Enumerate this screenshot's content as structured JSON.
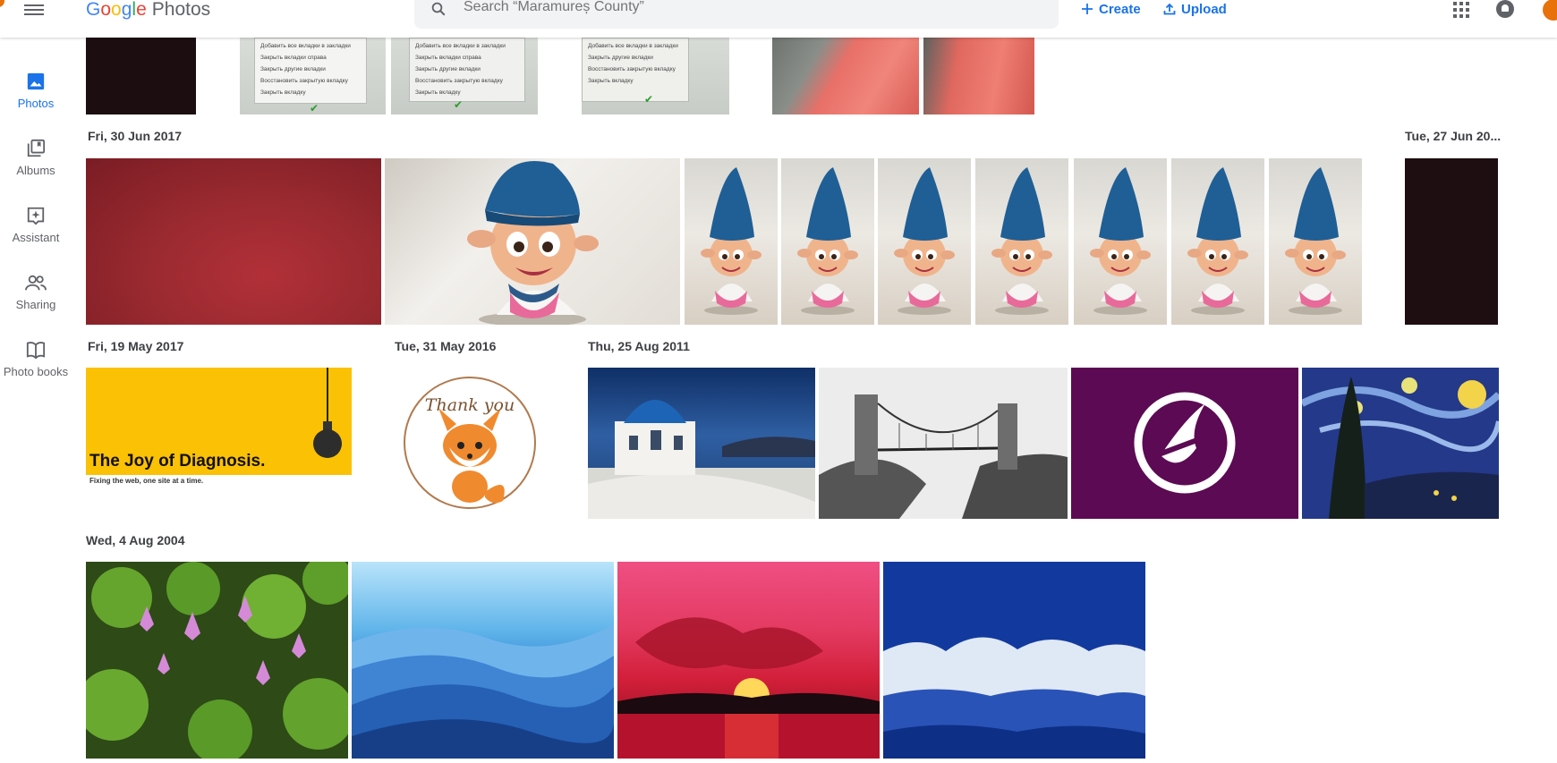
{
  "header": {
    "logo_google": "Google",
    "logo_product": "Photos",
    "search_placeholder": "Search “Maramureș County”",
    "create_label": "Create",
    "upload_label": "Upload",
    "icons": [
      "menu-icon",
      "search-icon",
      "plus-icon",
      "upload-icon",
      "apps-icon",
      "notifications-icon",
      "avatar"
    ]
  },
  "sidebar": {
    "items": [
      {
        "label": "Photos",
        "icon": "photos-icon",
        "active": true
      },
      {
        "label": "Albums",
        "icon": "albums-icon",
        "active": false
      },
      {
        "label": "Assistant",
        "icon": "assistant-icon",
        "active": false
      },
      {
        "label": "Sharing",
        "icon": "sharing-icon",
        "active": false
      },
      {
        "label": "Photo books",
        "icon": "photo-books-icon",
        "active": false
      }
    ]
  },
  "date_groups": [
    {
      "date": "Fri, 30 Jun 2017"
    },
    {
      "date": "Tue, 27 Jun 20..."
    },
    {
      "date": "Fri, 19 May 2017"
    },
    {
      "date": "Tue, 31 May 2016"
    },
    {
      "date": "Thu, 25 Aug 2011"
    },
    {
      "date": "Wed, 4 Aug 2004"
    }
  ],
  "photo_text": {
    "screenshot_menu": [
      "Добавить все вкладки в закладки",
      "Закрыть вкладки справа",
      "Закрыть другие вкладки",
      "Восстановить закрытую вкладку",
      "Закрыть вкладку"
    ],
    "joy_title": "The Joy of Diagnosis.",
    "joy_subtitle": "Fixing the web, one site at a time.",
    "thank_you": "Thank you"
  },
  "colors": {
    "accent": "#1a73e8",
    "joy_yellow": "#fbc105",
    "purple_logo": "#5c0a53"
  }
}
